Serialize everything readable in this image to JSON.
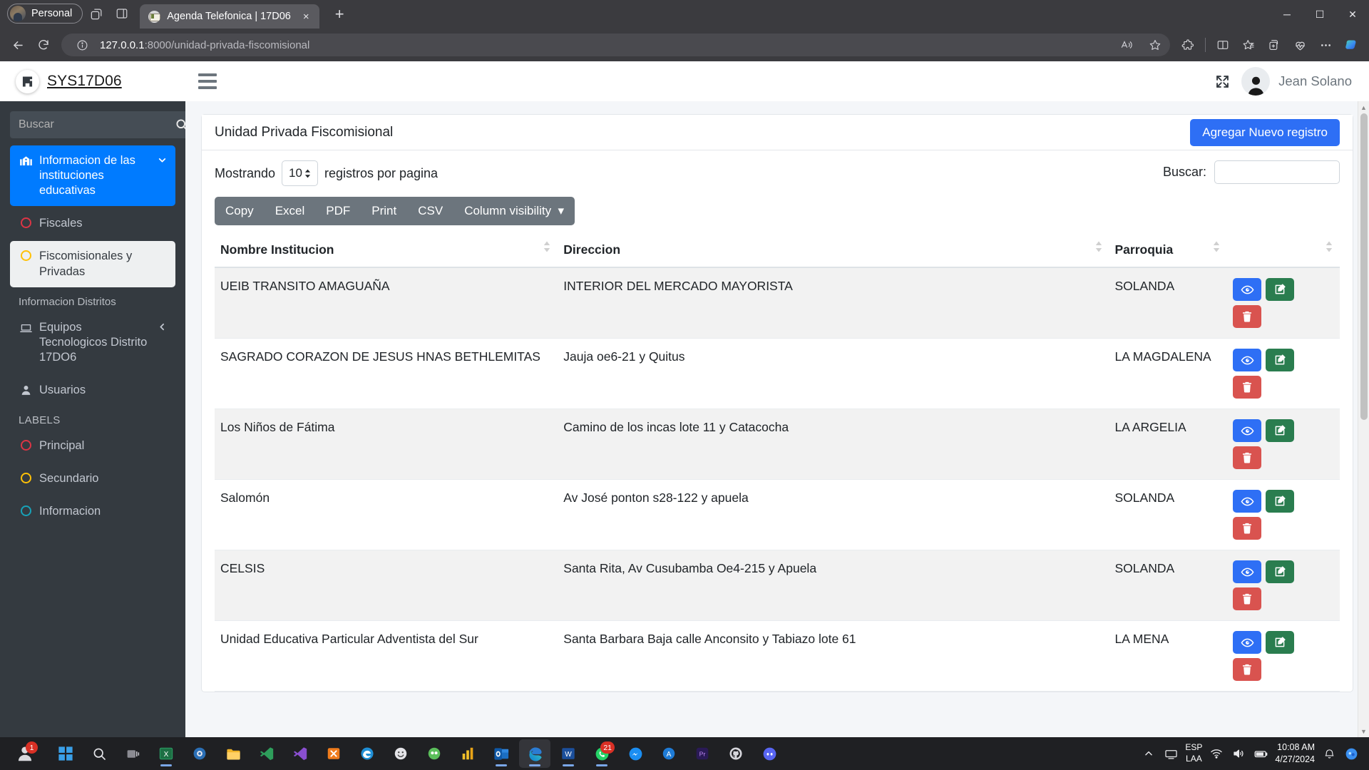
{
  "browser": {
    "profile_label": "Personal",
    "tab": {
      "title": "Agenda Telefonica | 17D06",
      "close_label": "×"
    },
    "new_tab_label": "+",
    "window_controls": {
      "minimize": "─",
      "maximize": "☐",
      "close": "✕"
    },
    "address": {
      "host": "127.0.0.1",
      "path": ":8000/unidad-privada-fiscomisional"
    },
    "toolbar_icons": [
      "read-aloud-icon",
      "favorite-star-icon",
      "extensions-icon",
      "split-screen-icon",
      "collections-icon",
      "add-to-collection-icon",
      "browser-essentials-icon",
      "settings-more-icon",
      "copilot-icon"
    ]
  },
  "sidebar": {
    "brand": "SYS17D06",
    "search_placeholder": "Buscar",
    "nav": {
      "main_item": {
        "label": "Informacion de las instituciones educativas",
        "icon": "school-icon",
        "caret": "chevron-down-icon"
      },
      "sub_items": [
        {
          "label": "Fiscales",
          "ring_color": "#dc3545"
        },
        {
          "label": "Fiscomisionales y Privadas",
          "ring_color": "#ffc107"
        }
      ],
      "section_distritos": "Informacion Distritos",
      "distrito_item": {
        "label": "Equipos Tecnologicos Distrito 17DO6",
        "icon": "laptop-icon",
        "caret": "chevron-left-icon"
      },
      "usuarios_item": {
        "label": "Usuarios",
        "icon": "user-icon"
      },
      "section_labels": "LABELS",
      "labels": [
        {
          "label": "Principal",
          "ring_color": "#dc3545"
        },
        {
          "label": "Secundario",
          "ring_color": "#ffc107"
        },
        {
          "label": "Informacion",
          "ring_color": "#17a2b8"
        }
      ]
    }
  },
  "topnav": {
    "menu_toggle": "hamburger-icon",
    "fullscreen": "expand-arrows-icon",
    "user_name": "Jean Solano"
  },
  "page": {
    "card_title": "Unidad Privada Fiscomisional",
    "add_button": "Agregar Nuevo registro",
    "length_prefix": "Mostrando",
    "length_value": "10",
    "length_suffix": "registros por pagina",
    "search_label": "Buscar:",
    "search_value": "",
    "export_buttons": [
      "Copy",
      "Excel",
      "PDF",
      "Print",
      "CSV"
    ],
    "column_visibility": "Column visibility",
    "table": {
      "columns": [
        "Nombre Institucion",
        "Direccion",
        "Parroquia",
        ""
      ],
      "rows": [
        {
          "nombre": "UEIB TRANSITO AMAGUAÑA",
          "direccion": "INTERIOR DEL MERCADO MAYORISTA",
          "parroquia": "SOLANDA"
        },
        {
          "nombre": "SAGRADO CORAZON DE JESUS HNAS BETHLEMITAS",
          "direccion": "Jauja oe6-21 y Quitus",
          "parroquia": "LA MAGDALENA"
        },
        {
          "nombre": "Los Niños de Fátima",
          "direccion": "Camino de los incas lote 11 y Catacocha",
          "parroquia": "LA ARGELIA"
        },
        {
          "nombre": "Salomón",
          "direccion": "Av José ponton s28-122 y apuela",
          "parroquia": "SOLANDA"
        },
        {
          "nombre": "CELSIS",
          "direccion": "Santa Rita, Av Cusubamba Oe4-215 y Apuela",
          "parroquia": "SOLANDA"
        },
        {
          "nombre": "Unidad Educativa Particular Adventista del Sur",
          "direccion": "Santa Barbara Baja calle Anconsito y Tabiazo lote 61",
          "parroquia": "LA MENA"
        }
      ],
      "action_icons": {
        "view": "eye-icon",
        "edit": "pencil-square-icon",
        "delete": "trash-icon"
      }
    }
  },
  "taskbar": {
    "start": "windows-start-icon",
    "apps": [
      "search-icon",
      "task-view-icon",
      "excel-icon",
      "blender-icon",
      "file-explorer-icon",
      "vs-code-insiders-icon",
      "visual-studio-icon",
      "xampp-icon",
      "edge-legacy-icon",
      "emoji-app-icon",
      "gmail-meet-icon",
      "power-bi-icon",
      "outlook-icon",
      "edge-icon",
      "word-icon",
      "whatsapp-icon",
      "messenger-icon",
      "antivirus-icon",
      "premiere-pro-icon",
      "github-icon",
      "discord-icon"
    ],
    "whatsapp_badge": "21",
    "overflow": "show-hidden-icons-icon",
    "language": {
      "line1": "ESP",
      "line2": "LAA"
    },
    "clock": {
      "time": "10:08 AM",
      "date": "4/27/2024"
    },
    "notifications": "notification-bell-icon"
  }
}
